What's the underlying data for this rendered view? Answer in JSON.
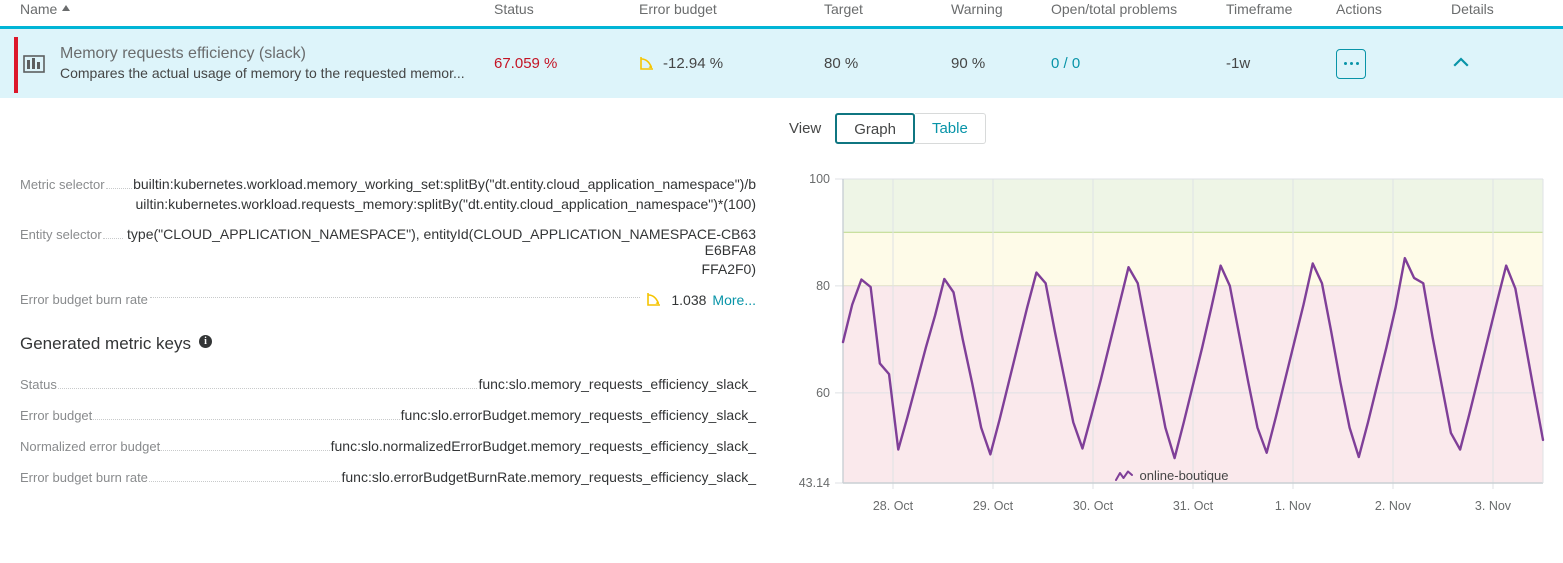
{
  "colors": {
    "teal": "#00b5d6",
    "teal_text": "#0894a8",
    "row_bg": "#ddf4fa",
    "status_red": "#c41425",
    "accent_red": "#dc172a",
    "series_purple": "#7f3f98",
    "band_green": "#eef5e6",
    "band_yellow": "#fefbe8",
    "band_pink": "#fae9ec",
    "line_green": "#8cc04b",
    "line_yellow": "#e8c000"
  },
  "table": {
    "headers": {
      "name": "Name",
      "status": "Status",
      "error_budget": "Error budget",
      "target": "Target",
      "warning": "Warning",
      "problems": "Open/total problems",
      "timeframe": "Timeframe",
      "actions": "Actions",
      "details": "Details"
    },
    "sort_icon": "sort-ascending-icon",
    "row": {
      "icon": "slo-bar-chart-icon",
      "title": "Memory requests efficiency (slack)",
      "description": "Compares the actual usage of memory to the requested memor...",
      "status": "67.059 %",
      "error_budget": "-12.94 %",
      "error_budget_icon": "trend-down-icon",
      "target": "80 %",
      "warning": "90 %",
      "problems": "0 / 0",
      "timeframe": "-1w",
      "actions_icon": "ellipsis-icon",
      "details_icon": "chevron-up-icon"
    }
  },
  "details": {
    "metric_selector": {
      "label": "Metric selector",
      "line1": "builtin:kubernetes.workload.memory_working_set:splitBy(\"dt.entity.cloud_application_namespace\")/b",
      "line2": "uiltin:kubernetes.workload.requests_memory:splitBy(\"dt.entity.cloud_application_namespace\")*(100)"
    },
    "entity_selector": {
      "label": "Entity selector",
      "line1": "type(\"CLOUD_APPLICATION_NAMESPACE\"), entityId(CLOUD_APPLICATION_NAMESPACE-CB63E6BFA8",
      "line2": "FFA2F0)"
    },
    "burn_rate": {
      "label": "Error budget burn rate",
      "icon": "trend-down-icon",
      "value": "1.038",
      "more": "More..."
    },
    "generated_metric_keys": {
      "title": "Generated metric keys",
      "info_icon": "info-icon",
      "info_glyph": "i",
      "rows": [
        {
          "label": "Status",
          "value": "func:slo.memory_requests_efficiency_slack_"
        },
        {
          "label": "Error budget",
          "value": "func:slo.errorBudget.memory_requests_efficiency_slack_"
        },
        {
          "label": "Normalized error budget",
          "value": "func:slo.normalizedErrorBudget.memory_requests_efficiency_slack_"
        },
        {
          "label": "Error budget burn rate",
          "value": "func:slo.errorBudgetBurnRate.memory_requests_efficiency_slack_"
        }
      ]
    }
  },
  "view": {
    "label": "View",
    "graph_label": "Graph",
    "table_label": "Table",
    "selected": "Graph"
  },
  "chart_data": {
    "type": "line",
    "title": "",
    "xlabel": "",
    "ylabel": "",
    "ylim": [
      43.14,
      100
    ],
    "yticks": [
      43.14,
      60,
      80,
      100
    ],
    "ytick_labels": [
      "43.14",
      "60",
      "80",
      "100"
    ],
    "xticks": [
      "28. Oct",
      "29. Oct",
      "30. Oct",
      "31. Oct",
      "1. Nov",
      "2. Nov",
      "3. Nov"
    ],
    "grid": true,
    "legend_position": "bottom",
    "legend": [
      "online-boutique"
    ],
    "bands": [
      {
        "name": "above-warning",
        "from": 90,
        "to": 100,
        "fill": "#eef5e6",
        "line": "#8cc04b"
      },
      {
        "name": "warning",
        "from": 80,
        "to": 90,
        "fill": "#fefbe8",
        "line": "#e8c000"
      },
      {
        "name": "breach",
        "from": 43.14,
        "to": 80,
        "fill": "#fae9ec",
        "line": ""
      }
    ],
    "series": [
      {
        "name": "online-boutique",
        "color": "#7f3f98",
        "x": [
          0,
          1,
          2,
          3,
          4,
          5,
          6,
          7,
          8,
          9,
          10,
          11,
          12,
          13,
          14,
          15,
          16,
          17,
          18,
          19,
          20,
          21,
          22,
          23,
          24,
          25,
          26,
          27,
          28,
          29,
          30,
          31,
          32,
          33,
          34,
          35,
          36,
          37,
          38,
          39,
          40,
          41,
          42,
          43,
          44,
          45,
          46,
          47,
          48,
          49,
          50,
          51,
          52,
          53,
          54,
          55,
          56,
          57,
          58,
          59,
          60,
          61,
          62,
          63,
          64,
          65,
          66,
          67,
          68,
          69,
          70,
          71,
          72,
          73,
          74,
          75,
          76
        ],
        "values": [
          69.5,
          76.5,
          81.2,
          79.8,
          65.5,
          63.5,
          49.4,
          55.5,
          62,
          68.5,
          74.5,
          81.3,
          78.8,
          70,
          62,
          53.5,
          48.5,
          55,
          62,
          69,
          76,
          82.5,
          80.5,
          71.5,
          63,
          54.5,
          49.6,
          56,
          62.5,
          69.5,
          76.5,
          83.5,
          80.5,
          71.5,
          62.5,
          53.5,
          47.8,
          54.5,
          61.5,
          68.5,
          76,
          83.8,
          80,
          71,
          62,
          53.5,
          48.8,
          55.5,
          62.5,
          69.5,
          76.5,
          84.2,
          80.5,
          71.5,
          62,
          53.5,
          48,
          54.5,
          61.5,
          68.5,
          76,
          85.2,
          81.5,
          80.5,
          70.5,
          61.5,
          52.5,
          49.4,
          56,
          63,
          70,
          77,
          83.8,
          79.5,
          70,
          60.5,
          51.2
        ]
      }
    ]
  }
}
